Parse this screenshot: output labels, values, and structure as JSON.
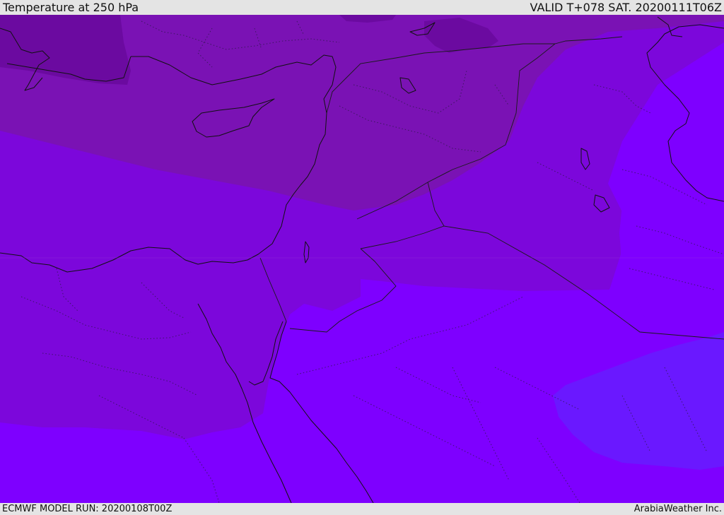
{
  "header": {
    "title": "Temperature at 250 hPa",
    "valid": "VALID T+078 SAT. 20200111T06Z"
  },
  "footer": {
    "model_run": "ECMWF MODEL RUN: 20200108T00Z",
    "credit": "ArabiaWeather Inc."
  },
  "map": {
    "variable": "temperature",
    "level": "250 hPa",
    "colors": {
      "coldest_band": "#6b0aa0",
      "cold_band": "#7a12b4",
      "mid_band": "#7c07db",
      "base_band": "#7e00ff",
      "warm_band": "#6a18ff",
      "coast_line": "#111111"
    }
  }
}
